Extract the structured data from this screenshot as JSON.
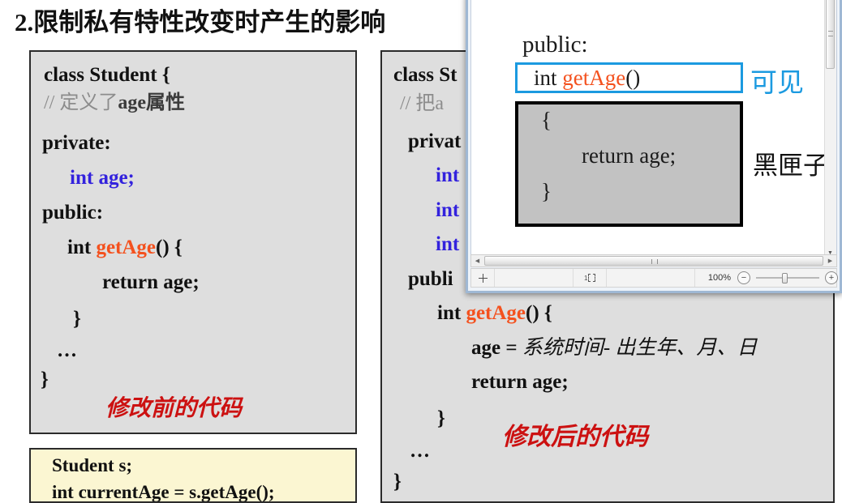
{
  "slide": {
    "heading": "2.限制私有特性改变时产生的影响"
  },
  "before_panel": {
    "lines": [
      "class Student {",
      "// 定义了age属性",
      "private:",
      "int age;",
      "public:",
      "int getAge() {",
      "return age;",
      "}",
      "…",
      "}"
    ],
    "comment_prefix": "// ",
    "comment_cn1": "定义了",
    "comment_code": "age",
    "comment_cn2": "属性",
    "kw_int": "int",
    "kw_age_decl": "age;",
    "kw_int2": "int",
    "kw_getage": "getAge",
    "kw_parens": "() {",
    "annotation": "修改前的代码"
  },
  "after_panel": {
    "line_class": "class St",
    "line_comment": "// 把a",
    "line_private": "privat",
    "line_int1": "int",
    "line_int2": "int",
    "line_int3": "int",
    "line_public": "publi",
    "kw_int_get": "int",
    "kw_getage": "getAge",
    "kw_parens": "() {",
    "line_age_assign_code": "age = ",
    "line_age_assign_cn": "系统时间- 出生年、月、日",
    "line_return": "return  age;",
    "line_close_brace": "}",
    "line_ellipsis": "…",
    "line_close_class": "}",
    "annotation": "修改后的代码"
  },
  "usage_panel": {
    "line1": "Student s;",
    "line2": "int currentAge  = s.getAge();"
  },
  "float_window": {
    "doc": {
      "public_label": "public:",
      "signature_int": "int ",
      "signature_name": "getAge",
      "signature_parens": "()",
      "body_open": "{",
      "body_return": "return age;",
      "body_close": "}"
    },
    "labels": {
      "visible": "可见",
      "blackbox": "黑匣子"
    },
    "statusbar": {
      "move_icon": "move-cursor-icon",
      "select_icon": "selection-icon",
      "zoom_level": "100%",
      "zoom_out": "−",
      "zoom_in": "+"
    },
    "scrollbars": {
      "h_left_arrow": "◀",
      "h_right_arrow": "▶",
      "v_down_arrow": "▼"
    }
  },
  "colors": {
    "keyword_blue": "#3322dd",
    "method_orange": "#f4511e",
    "annotation_red": "#cc1111",
    "visible_blue": "#1b9ae0",
    "panel_bg": "#dedede",
    "yellow_bg": "#fbf6d2"
  }
}
